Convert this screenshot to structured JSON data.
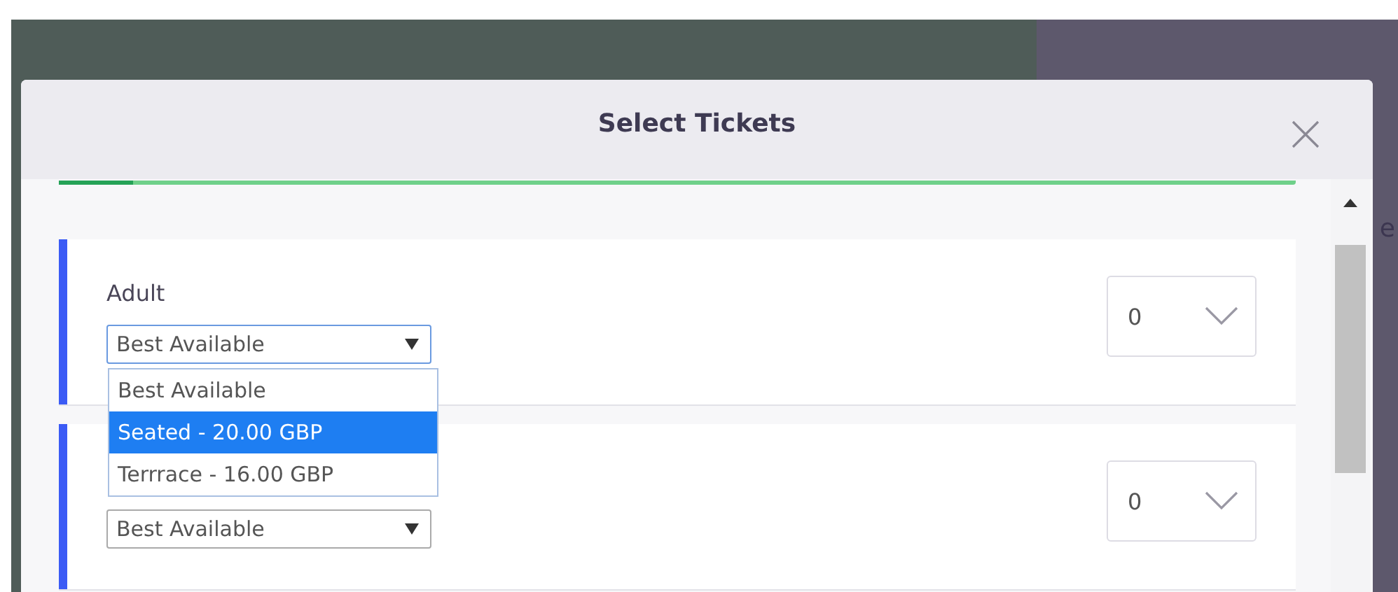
{
  "background_text": "e",
  "modal": {
    "title": "Select Tickets",
    "progress": {
      "level": 0.06
    },
    "tickets": [
      {
        "label": "Adult",
        "select_value": "Best Available",
        "quantity": "0",
        "dropdown_open": true,
        "options": [
          {
            "label": "Best Available",
            "selected": false
          },
          {
            "label": "Seated - 20.00 GBP",
            "selected": true
          },
          {
            "label": "Terrrace - 16.00 GBP",
            "selected": false
          }
        ]
      },
      {
        "select_value": "Best Available",
        "quantity": "0",
        "dropdown_open": false
      }
    ]
  }
}
